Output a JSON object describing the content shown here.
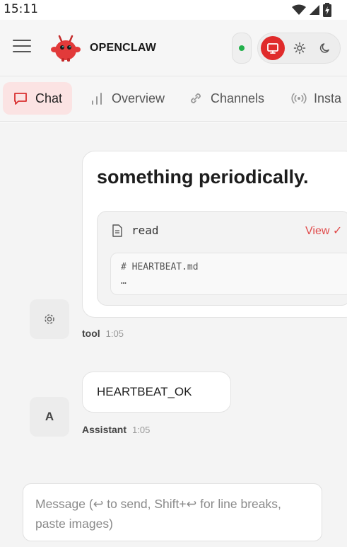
{
  "status_bar": {
    "time": "15:11"
  },
  "header": {
    "brand": "OPENCLAW"
  },
  "tabs": [
    {
      "label": "Chat",
      "icon": "chat-bubble-icon",
      "active": true
    },
    {
      "label": "Overview",
      "icon": "bar-chart-icon"
    },
    {
      "label": "Channels",
      "icon": "link-icon"
    },
    {
      "label": "Insta",
      "icon": "broadcast-icon"
    }
  ],
  "chat": {
    "tool_message": {
      "text": "something periodically.",
      "tool_card": {
        "name": "read",
        "view_label": "View ✓",
        "code_lines": [
          "# HEARTBEAT.md",
          "…"
        ]
      },
      "sender": "tool",
      "time": "1:05"
    },
    "assistant_message": {
      "avatar_letter": "A",
      "text": "HEARTBEAT_OK",
      "sender": "Assistant",
      "time": "1:05"
    }
  },
  "composer": {
    "placeholder": "Message (↩ to send, Shift+↩ for line breaks, paste images)"
  },
  "colors": {
    "accent": "#e02b2b",
    "active_tab_bg": "#fbe3e3",
    "online": "#22b04b",
    "link": "#e04a4a"
  }
}
